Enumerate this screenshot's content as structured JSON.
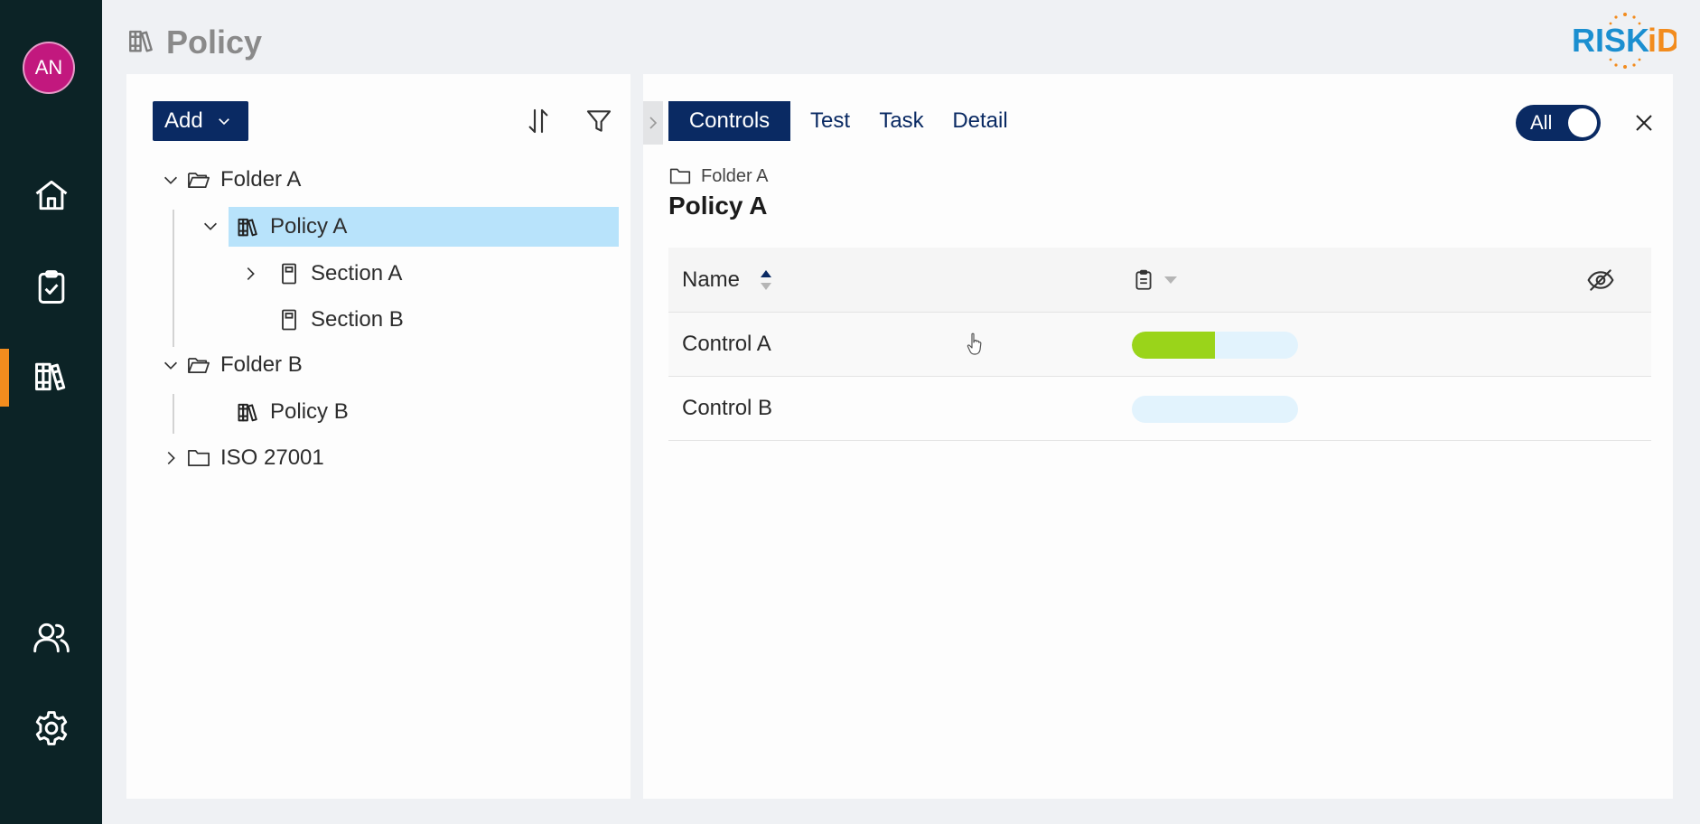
{
  "sidebar": {
    "avatar_initials": "AN",
    "items": [
      {
        "name": "home",
        "icon": "home-icon"
      },
      {
        "name": "tasks",
        "icon": "clipboard-check-icon"
      },
      {
        "name": "policy",
        "icon": "books-icon",
        "active": true
      },
      {
        "name": "users",
        "icon": "users-icon"
      },
      {
        "name": "settings",
        "icon": "gear-icon"
      }
    ]
  },
  "header": {
    "title": "Policy",
    "icon": "books-icon",
    "logo_text": "RISKiD"
  },
  "left_panel": {
    "add_label": "Add",
    "tree": [
      {
        "label": "Folder A",
        "icon": "folder-open-icon",
        "expanded": true
      },
      {
        "label": "Policy A",
        "icon": "books-icon",
        "expanded": true,
        "selected": true
      },
      {
        "label": "Section A",
        "icon": "document-icon",
        "expanded": false
      },
      {
        "label": "Section B",
        "icon": "document-icon"
      },
      {
        "label": "Folder B",
        "icon": "folder-open-icon",
        "expanded": true
      },
      {
        "label": "Policy B",
        "icon": "books-icon"
      },
      {
        "label": "ISO 27001",
        "icon": "folder-icon",
        "expanded": false
      }
    ]
  },
  "right_panel": {
    "tabs": [
      "Controls",
      "Test",
      "Task",
      "Detail"
    ],
    "active_tab": "Controls",
    "toggle_label": "All",
    "breadcrumb": "Folder A",
    "title": "Policy A",
    "table": {
      "columns": [
        "Name"
      ],
      "rows": [
        {
          "name": "Control A",
          "progress": 0.5
        },
        {
          "name": "Control B",
          "progress": 0
        }
      ]
    }
  },
  "colors": {
    "sidebar_bg": "#0c2326",
    "accent_orange": "#f28c1e",
    "primary_navy": "#0a2a63",
    "selected_bg": "#b8e3fb",
    "progress_fill": "#9ad41a",
    "progress_track": "#e2f3fd",
    "avatar_bg": "#c2187e"
  }
}
